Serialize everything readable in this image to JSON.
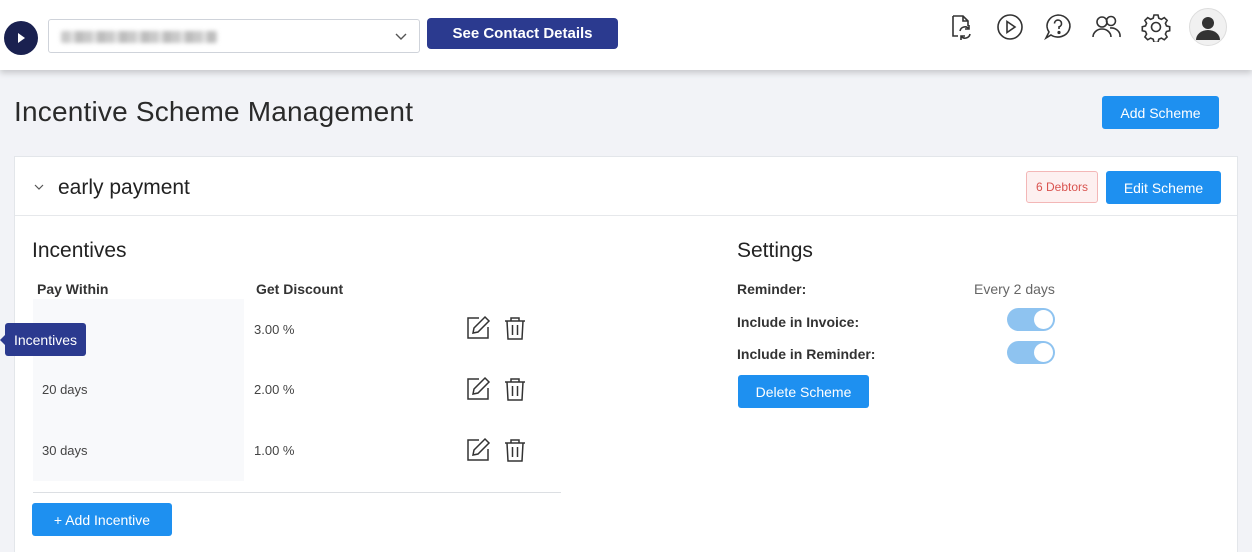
{
  "topbar": {
    "org_select": {
      "value": ""
    },
    "contact_button": "See Contact Details",
    "icons": [
      "sync-document-icon",
      "play-circle-icon",
      "help-bubble-icon",
      "users-icon",
      "settings-gear-icon",
      "user-avatar-icon"
    ]
  },
  "page": {
    "title": "Incentive Scheme Management",
    "add_scheme_button": "Add Scheme"
  },
  "scheme": {
    "name": "early payment",
    "debtors_badge": "6 Debtors",
    "edit_button": "Edit Scheme",
    "incentives": {
      "title": "Incentives",
      "col_pay_within": "Pay Within",
      "col_get_discount": "Get Discount",
      "rows": [
        {
          "pay_within": "",
          "discount": "3.00 %"
        },
        {
          "pay_within": "20 days",
          "discount": "2.00 %"
        },
        {
          "pay_within": "30 days",
          "discount": "1.00 %"
        }
      ],
      "add_button": "+  Add Incentive"
    },
    "settings": {
      "title": "Settings",
      "reminder_label": "Reminder:",
      "reminder_value": "Every 2 days",
      "include_invoice_label": "Include in Invoice:",
      "include_invoice_on": true,
      "include_reminder_label": "Include in Reminder:",
      "include_reminder_on": true,
      "delete_button": "Delete Scheme"
    }
  },
  "tooltip": "Incentives",
  "colors": {
    "primary_button": "#1e90f0",
    "navy": "#2b3a8f",
    "logo_bg": "#1a2150",
    "toggle_on": "#8ec3f0",
    "badge_text": "#d9534f"
  }
}
